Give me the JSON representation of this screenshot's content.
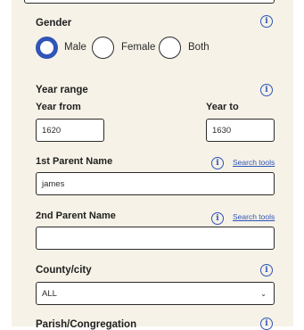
{
  "gender": {
    "label": "Gender",
    "options": [
      {
        "label": "Male",
        "checked": true
      },
      {
        "label": "Female",
        "checked": false
      },
      {
        "label": "Both",
        "checked": false
      }
    ]
  },
  "year_range": {
    "label": "Year range",
    "from_label": "Year from",
    "from_value": "1620",
    "to_label": "Year to",
    "to_value": "1630"
  },
  "parent1": {
    "label": "1st Parent Name",
    "search_tools": "Search tools",
    "value": "james"
  },
  "parent2": {
    "label": "2nd Parent Name",
    "search_tools": "Search tools",
    "value": ""
  },
  "county": {
    "label": "County/city",
    "selected": "ALL"
  },
  "parish": {
    "label": "Parish/Congregation"
  },
  "icons": {
    "info": "i",
    "chevron": "⌄"
  },
  "colors": {
    "accent": "#2f55b8",
    "panel_bg": "#f6f2e7"
  }
}
